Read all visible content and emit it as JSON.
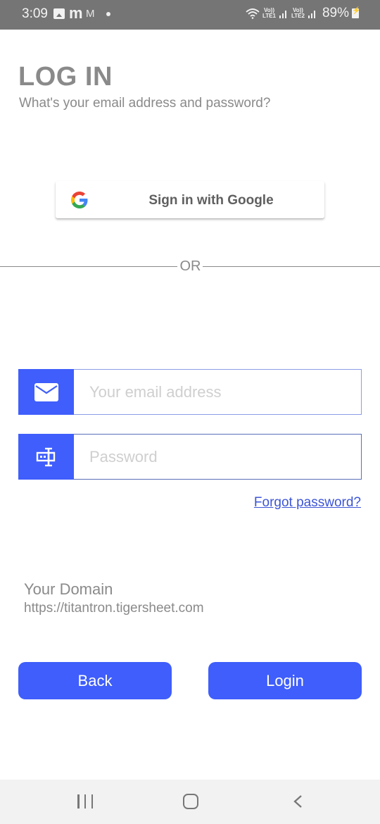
{
  "status_bar": {
    "time": "3:09",
    "notification_icons": [
      "gallery-icon",
      "m-app-icon",
      "gmail-icon",
      "dot-icon"
    ],
    "sim1": {
      "top": "Vo))",
      "bottom": "LTE1"
    },
    "sim2": {
      "top": "Vo))",
      "bottom": "LTE2"
    },
    "battery_percent": "89%",
    "charging": true
  },
  "header": {
    "title": "LOG IN",
    "subtitle": "What's your email address and password?"
  },
  "google": {
    "label": "Sign in with Google",
    "colors": {
      "blue": "#4285F4",
      "red": "#EA4335",
      "yellow": "#FBBC05",
      "green": "#34A853"
    }
  },
  "divider": {
    "text": "OR"
  },
  "form": {
    "email": {
      "value": "",
      "placeholder": "Your email address"
    },
    "password": {
      "value": "",
      "placeholder": "Password"
    },
    "forgot_label": "Forgot password?"
  },
  "domain": {
    "label": "Your Domain",
    "value": "https://titantron.tigersheet.com"
  },
  "actions": {
    "back_label": "Back",
    "login_label": "Login"
  },
  "theme": {
    "accent": "#3F5EFB",
    "muted_text": "#8A8A8A",
    "link": "#3D55D6"
  },
  "nav_bar": {
    "recent": "recent-apps-icon",
    "home": "home-icon",
    "back": "back-icon"
  }
}
